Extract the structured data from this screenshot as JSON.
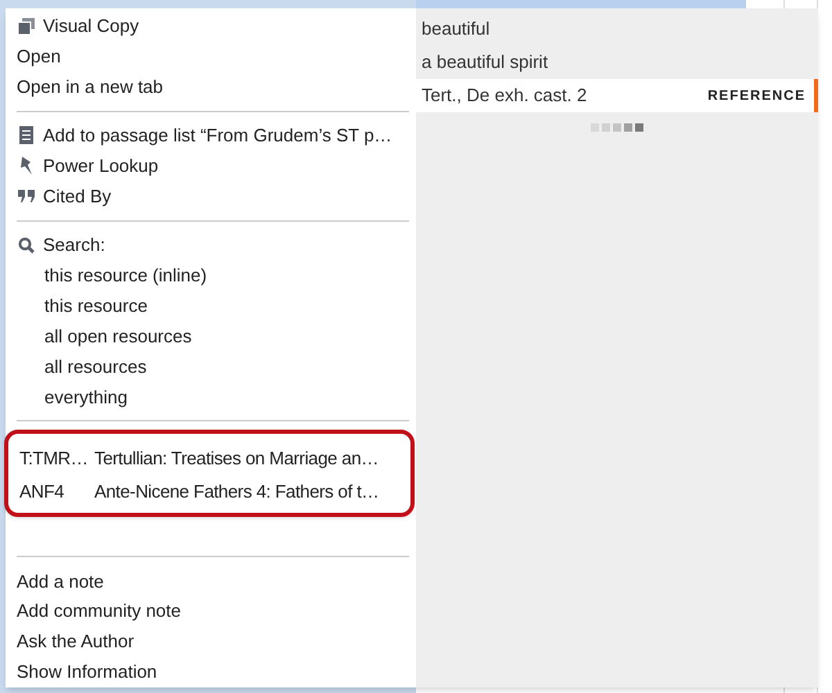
{
  "context_menu": {
    "sections": [
      {
        "items": [
          {
            "kind": "copy",
            "label": "Visual Copy"
          },
          {
            "kind": "plain",
            "label": "Open"
          },
          {
            "kind": "plain",
            "label": "Open in a new tab"
          }
        ]
      },
      {
        "items": [
          {
            "kind": "list",
            "label": "Add to passage list “From Grudem’s ST p…"
          },
          {
            "kind": "lookup",
            "label": "Power Lookup"
          },
          {
            "kind": "quote",
            "label": "Cited By"
          }
        ]
      },
      {
        "items": [
          {
            "kind": "search",
            "label": "Search:"
          },
          {
            "kind": "sub",
            "label": "this resource (inline)"
          },
          {
            "kind": "sub",
            "label": "this resource"
          },
          {
            "kind": "sub",
            "label": "all open resources"
          },
          {
            "kind": "sub",
            "label": "all resources"
          },
          {
            "kind": "sub",
            "label": "everything"
          }
        ]
      },
      {
        "circled": true,
        "resources": [
          {
            "abbrev": "T:TMR…",
            "title": "Tertullian: Treatises on Marriage an…"
          },
          {
            "abbrev": "ANF4",
            "title": "Ante-Nicene Fathers 4: Fathers of t…"
          }
        ]
      },
      {
        "items": [
          {
            "kind": "plain",
            "label": "Add a note"
          },
          {
            "kind": "plain",
            "label": "Add community note"
          },
          {
            "kind": "plain",
            "label": "Ask the Author"
          },
          {
            "kind": "plain",
            "label": "Show Information"
          }
        ]
      }
    ]
  },
  "suggestions": [
    {
      "text": "beautiful",
      "selected": false
    },
    {
      "text": "a beautiful spirit",
      "selected": false
    },
    {
      "text": "Tert., De exh. cast. 2",
      "tag": "REFERENCE",
      "selected": true
    }
  ],
  "loading": true
}
